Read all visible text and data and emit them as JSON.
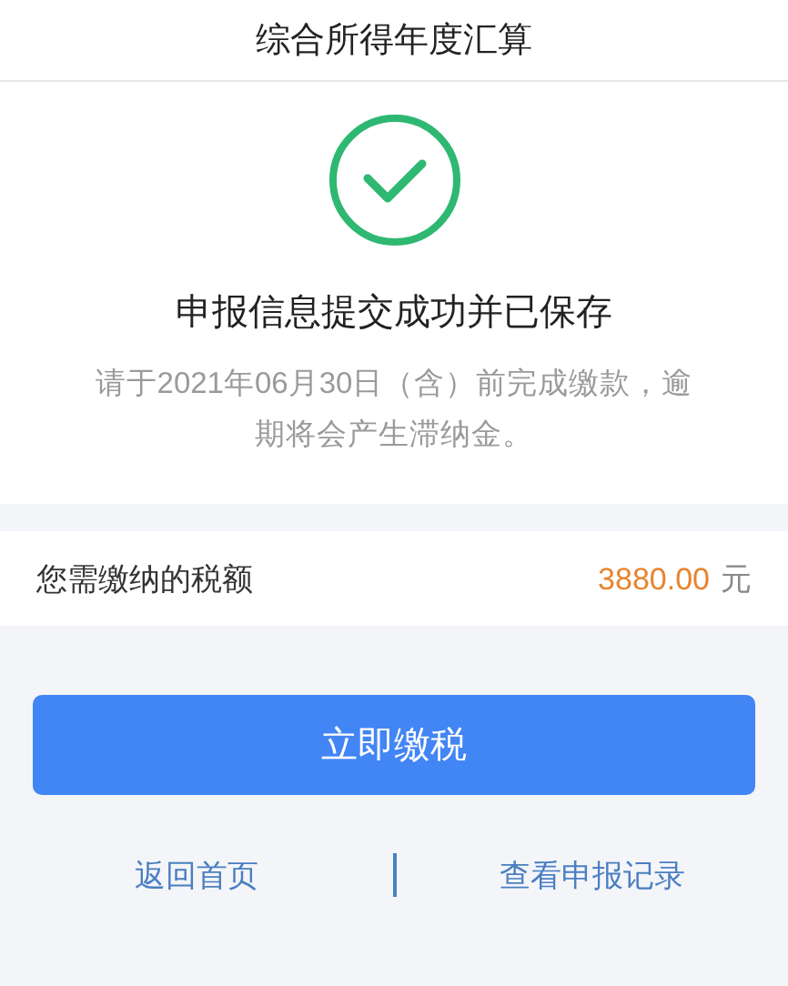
{
  "header": {
    "title": "综合所得年度汇算"
  },
  "result": {
    "message": "申报信息提交成功并已保存",
    "notice": "请于2021年06月30日（含）前完成缴款，逾期将会产生滞纳金。"
  },
  "tax": {
    "label": "您需缴纳的税额",
    "amount": "3880.00",
    "unit": "元"
  },
  "primary_button": {
    "label": "立即缴税"
  },
  "links": [
    {
      "label": "返回首页"
    },
    {
      "label": "查看申报记录"
    }
  ]
}
